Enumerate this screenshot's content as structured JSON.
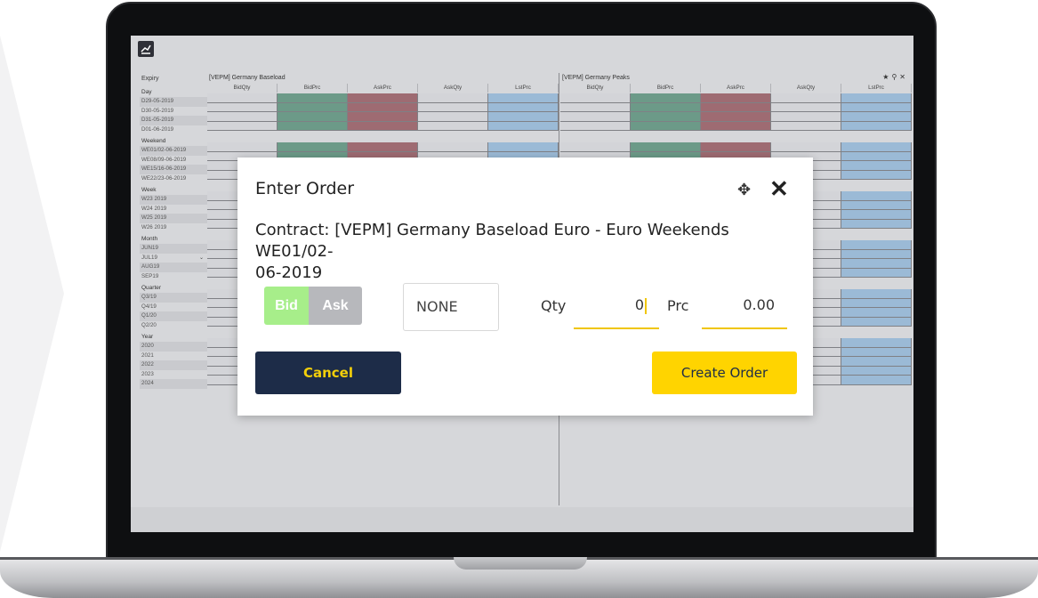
{
  "expiry": {
    "header": "Expiry",
    "groups": [
      {
        "label": "Day",
        "rows": [
          "D29-05-2019",
          "D30-05-2019",
          "D31-05-2019",
          "D01-06-2019"
        ]
      },
      {
        "label": "Weekend",
        "rows": [
          "WE01/02-06-2019",
          "WE08/09-06-2019",
          "WE15/16-06-2019",
          "WE22/23-06-2019"
        ]
      },
      {
        "label": "Week",
        "rows": [
          "W23 2019",
          "W24 2019",
          "W25 2019",
          "W26 2019"
        ]
      },
      {
        "label": "Month",
        "rows": [
          "JUN19",
          "JUL19",
          "AUG19",
          "SEP19"
        ]
      },
      {
        "label": "Quarter",
        "rows": [
          "Q3/19",
          "Q4/19",
          "Q1/20",
          "Q2/20"
        ]
      },
      {
        "label": "Year",
        "rows": [
          "2020",
          "2021",
          "2022",
          "2023",
          "2024"
        ]
      }
    ]
  },
  "panels": [
    {
      "title": "[VEPM] Germany Baseload",
      "columns": [
        "BidQty",
        "BidPrc",
        "AskPrc",
        "AskQty",
        "LstPrc"
      ]
    },
    {
      "title": "[VEPM] Germany Peaks",
      "columns": [
        "BidQty",
        "BidPrc",
        "AskPrc",
        "AskQty",
        "LstPrc"
      ]
    }
  ],
  "colors": {
    "bid": "#6c9a88",
    "ask": "#9e6b72",
    "last": "#9bbad6",
    "cancel_bg": "#1d2c48",
    "create_bg": "#ffd400",
    "accent_underline": "#f0c60a",
    "bid_toggle": "#a7ee8a"
  },
  "modal": {
    "title": "Enter Order",
    "contract_line1": "Contract: [VEPM] Germany Baseload Euro - Euro Weekends WE01/02-",
    "contract_line2": "06-2019",
    "side_bid": "Bid",
    "side_ask": "Ask",
    "order_type": "NONE",
    "qty_label": "Qty",
    "qty_value": "0",
    "prc_label": "Prc",
    "prc_value": "0.00",
    "cancel_label": "Cancel",
    "create_label": "Create Order"
  },
  "icons": {
    "move": "move-icon",
    "close": "close-icon",
    "panel_tools": [
      "star-icon",
      "pin-icon",
      "close-icon"
    ]
  }
}
